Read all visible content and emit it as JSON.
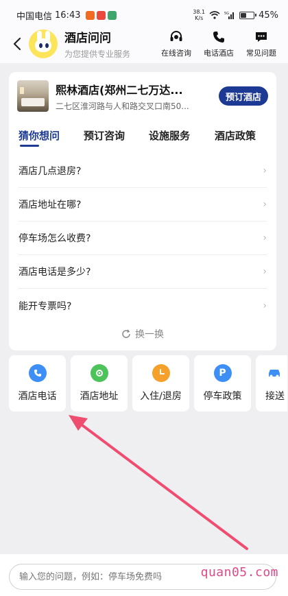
{
  "status_bar": {
    "carrier": "中国电信",
    "time": "16:43",
    "net_speed_value": "38.1",
    "net_speed_unit": "K/s",
    "signal_label": "5G",
    "battery_level": 0.45,
    "battery": "45%"
  },
  "header": {
    "title": "酒店问问",
    "subtitle": "为您提供专业服务",
    "actions": [
      {
        "label": "在线咨询",
        "icon": "headset-icon"
      },
      {
        "label": "电话酒店",
        "icon": "phone-icon"
      },
      {
        "label": "常见问题",
        "icon": "chat-icon"
      }
    ]
  },
  "hotel": {
    "name": "熙林酒店(郑州二七万达...",
    "address": "二七区淮河路与人和路交叉口南50...",
    "book_label": "预订酒店"
  },
  "tabs": [
    {
      "label": "猜你想问",
      "active": true
    },
    {
      "label": "预订咨询",
      "active": false
    },
    {
      "label": "设施服务",
      "active": false
    },
    {
      "label": "酒店政策",
      "active": false
    }
  ],
  "questions": [
    "酒店几点退房?",
    "酒店地址在哪?",
    "停车场怎么收费?",
    "酒店电话是多少?",
    "能开专票吗?"
  ],
  "refresh_label": "换一换",
  "quick_actions": [
    {
      "label": "酒店电话",
      "icon": "phone-icon",
      "color": "#3d8ff5"
    },
    {
      "label": "酒店地址",
      "icon": "location-icon",
      "color": "#4cc35b"
    },
    {
      "label": "入住/退房",
      "icon": "clock-icon",
      "color": "#f4a02a"
    },
    {
      "label": "停车政策",
      "icon": "parking-icon",
      "color": "#3d8ff5"
    },
    {
      "label": "接送",
      "icon": "car-icon",
      "color": "#3d8ff5"
    }
  ],
  "input": {
    "placeholder": "输入您的问题，例如：停车场免费吗"
  },
  "watermark": "quan05.com",
  "colors": {
    "accent": "#1c3a94",
    "annotation_arrow": "#ee4d6f"
  }
}
